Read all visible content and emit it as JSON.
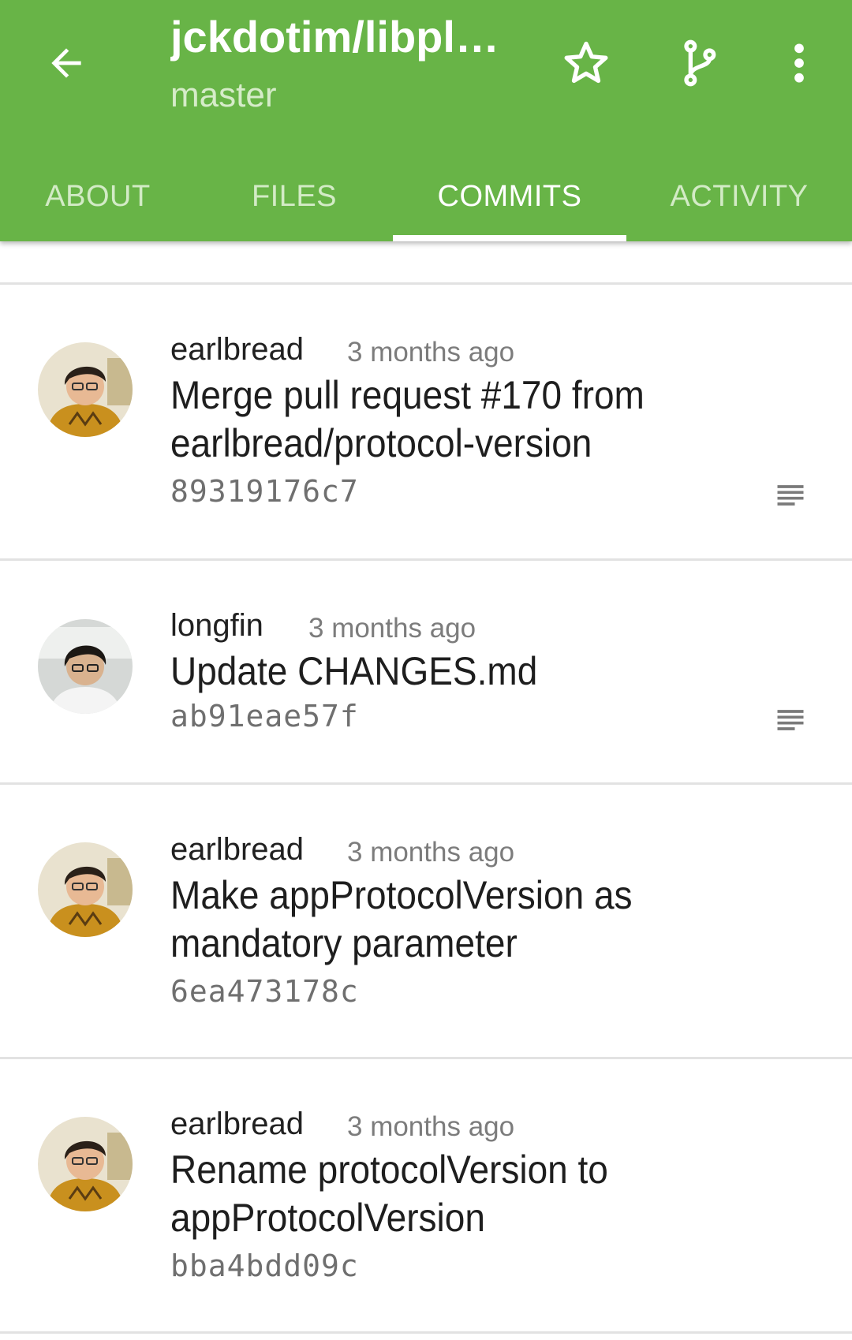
{
  "header": {
    "title": "jckdotim/libpl…",
    "branch": "master",
    "icons": {
      "back": "arrow-back-icon",
      "star": "star-outline-icon",
      "branch": "git-branch-icon",
      "more": "more-vert-icon"
    }
  },
  "tabs": [
    {
      "label": "ABOUT",
      "active": false
    },
    {
      "label": "FILES",
      "active": false
    },
    {
      "label": "COMMITS",
      "active": true
    },
    {
      "label": "ACTIVITY",
      "active": false
    }
  ],
  "commits": [
    {
      "author": "earlbread",
      "time": "3 months ago",
      "message_lines": [
        "Merge pull request #170 from",
        "earlbread/protocol-version"
      ],
      "sha": "89319176c7",
      "has_description": true
    },
    {
      "author": "longfin",
      "time": "3 months ago",
      "message_lines": [
        "Update CHANGES.md"
      ],
      "sha": "ab91eae57f",
      "has_description": true
    },
    {
      "author": "earlbread",
      "time": "3 months ago",
      "message_lines": [
        "Make appProtocolVersion as",
        "mandatory parameter"
      ],
      "sha": "6ea473178c",
      "has_description": false
    },
    {
      "author": "earlbread",
      "time": "3 months ago",
      "message_lines": [
        "Rename protocolVersion to",
        "appProtocolVersion"
      ],
      "sha": "bba4bdd09c",
      "has_description": false
    }
  ],
  "colors": {
    "toolbar": "#68b447",
    "tab_inactive": "#d3ebc6",
    "tab_active": "#ffffff",
    "divider": "#e2e2e2"
  }
}
